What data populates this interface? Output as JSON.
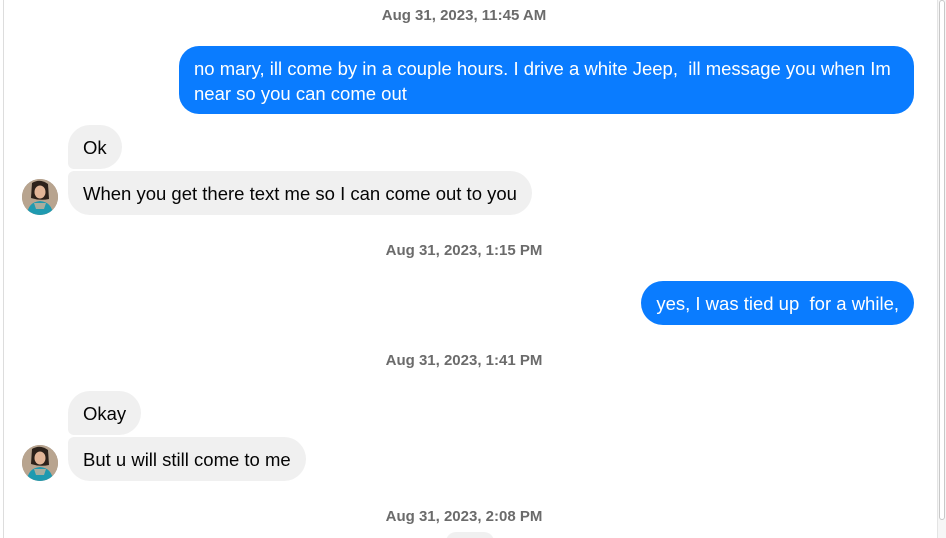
{
  "messages": [
    {
      "kind": "timestamp",
      "text": "Aug 31, 2023, 11:45 AM"
    },
    {
      "kind": "outgoing",
      "text": "no mary, ill come by in a couple hours. I drive a white Jeep,  ill message you when Im near so you can come out"
    },
    {
      "kind": "incoming",
      "text": "Ok"
    },
    {
      "kind": "incoming",
      "text": "When you get there text me so I can come out to you"
    },
    {
      "kind": "timestamp",
      "text": "Aug 31, 2023, 1:15 PM"
    },
    {
      "kind": "outgoing",
      "text": "yes, I was tied up  for a while,"
    },
    {
      "kind": "timestamp",
      "text": "Aug 31, 2023, 1:41 PM"
    },
    {
      "kind": "incoming",
      "text": "Okay"
    },
    {
      "kind": "incoming",
      "text": "But u will still come to me"
    },
    {
      "kind": "timestamp",
      "text": "Aug 31, 2023, 2:08 PM"
    }
  ],
  "colors": {
    "outgoing_bubble": "#0a7cff",
    "incoming_bubble": "#f0f0f0",
    "timestamp_text": "#6b6b6b"
  },
  "icons": {
    "contact_avatar": "contact-avatar-photo"
  }
}
